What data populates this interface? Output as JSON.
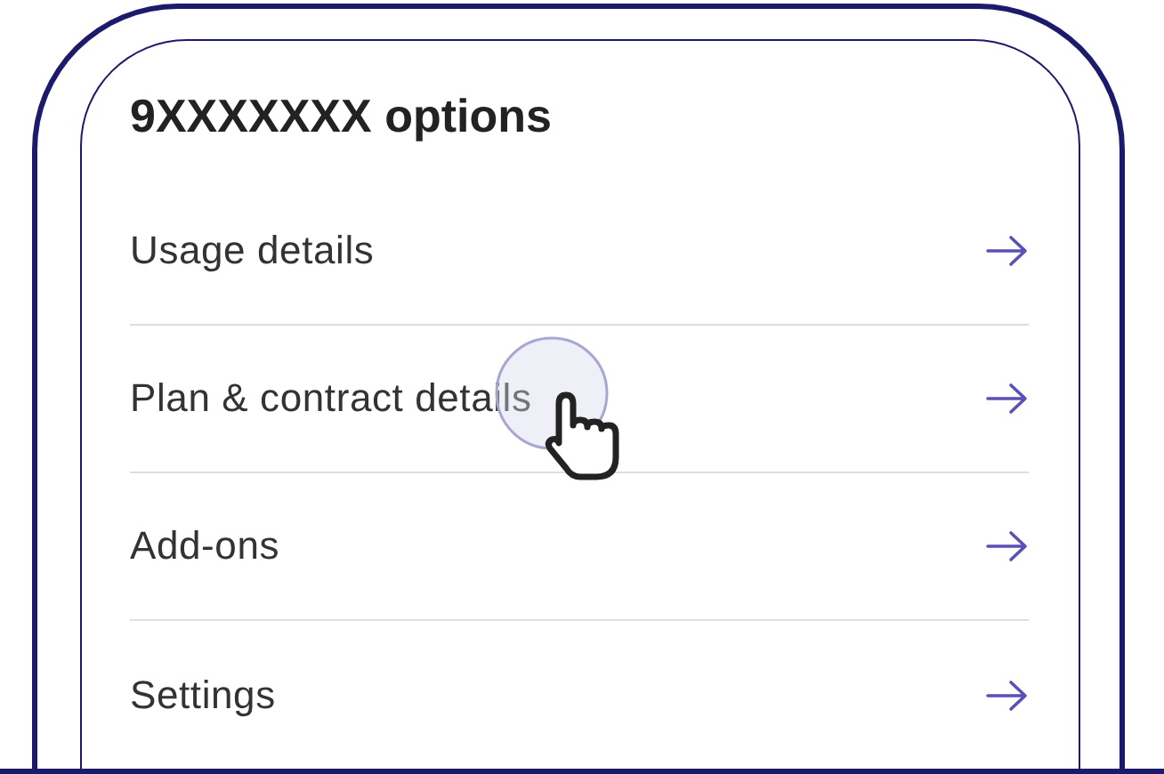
{
  "screen": {
    "title": "9XXXXXXX options"
  },
  "items": [
    {
      "label": "Usage details",
      "tapped": false
    },
    {
      "label": "Plan & contract details",
      "tapped": true
    },
    {
      "label": "Add-ons",
      "tapped": false
    },
    {
      "label": "Settings",
      "tapped": false
    }
  ]
}
